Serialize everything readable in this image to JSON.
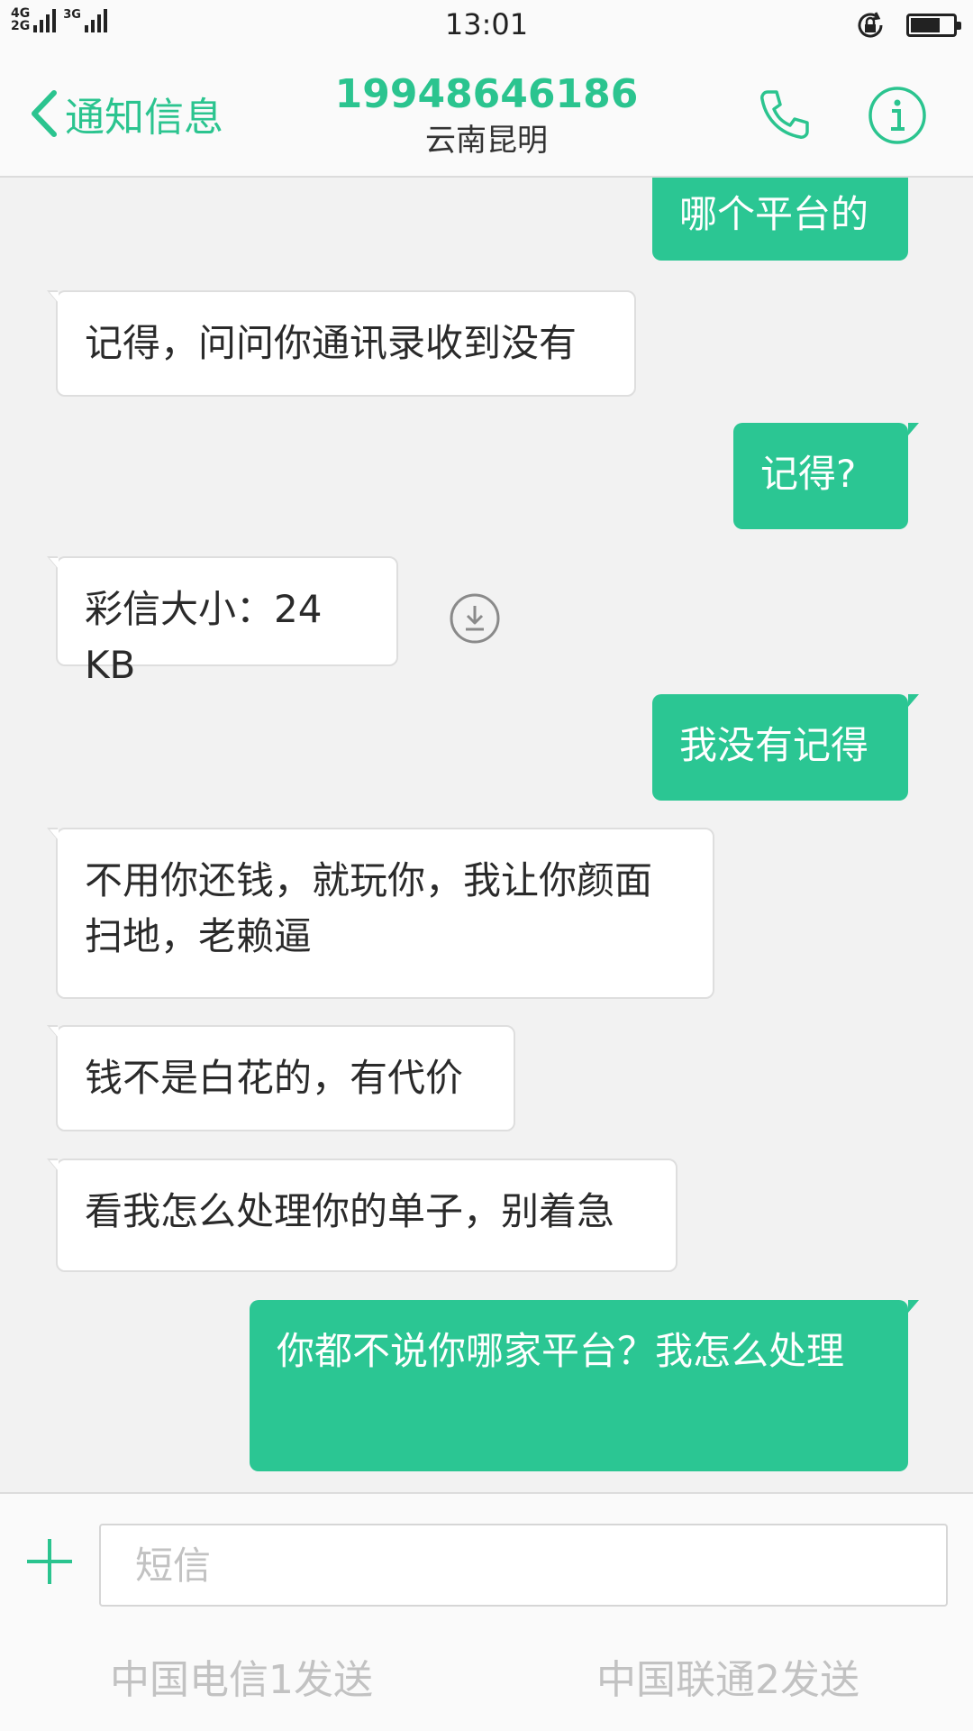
{
  "status_bar": {
    "time": "13:01",
    "network_top": "4G",
    "network_bottom": "2G",
    "network_secondary": "3G",
    "battery_level": 0.7,
    "icons": [
      "signal-icon",
      "rotation-lock-icon",
      "battery-icon"
    ]
  },
  "header": {
    "back_label": "通知信息",
    "contact_number": "19948646186",
    "contact_location": "云南昆明",
    "icons": [
      "back-chevron-icon",
      "phone-icon",
      "info-icon"
    ]
  },
  "messages": [
    {
      "direction": "out",
      "text": "哪个平台的"
    },
    {
      "direction": "in",
      "text": "记得，问问你通讯录收到没有"
    },
    {
      "direction": "out",
      "text": "记得?"
    },
    {
      "direction": "in",
      "text": "彩信大小：24 KB"
    },
    {
      "direction": "out",
      "text": "我没有记得"
    },
    {
      "direction": "in",
      "text": "不用你还钱，就玩你，我让你颜面扫地，老赖逼"
    },
    {
      "direction": "in",
      "text": "钱不是白花的，有代价"
    },
    {
      "direction": "in",
      "text": "看我怎么处理你的单子，别着急"
    },
    {
      "direction": "out",
      "text": "你都不说你哪家平台？我怎么处理"
    }
  ],
  "input": {
    "placeholder": "短信",
    "value": ""
  },
  "send": {
    "sim1_label": "中国电信1发送",
    "sim2_label": "中国联通2发送"
  },
  "colors": {
    "accent": "#2bc48f",
    "outgoing_bubble": "#2bc693",
    "incoming_bubble": "#ffffff",
    "background": "#f2f2f2"
  }
}
